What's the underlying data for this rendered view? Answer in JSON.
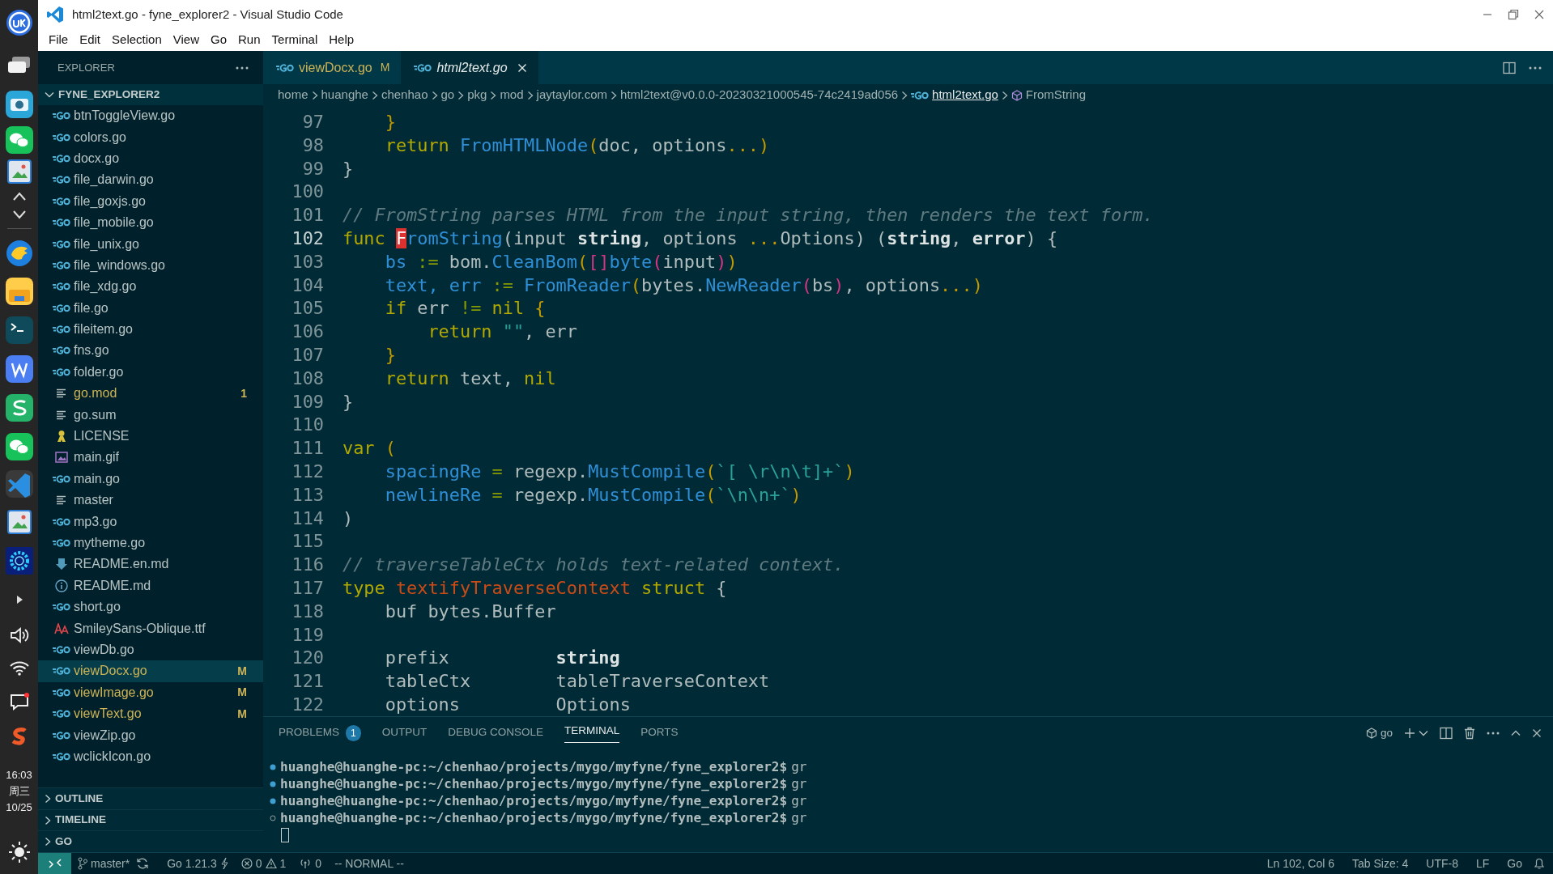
{
  "window": {
    "title": "html2text.go - fyne_explorer2 - Visual Studio Code"
  },
  "taskbar": {
    "time": "16:03",
    "weekday": "周三",
    "date": "10/25"
  },
  "menu": [
    "File",
    "Edit",
    "Selection",
    "View",
    "Go",
    "Run",
    "Terminal",
    "Help"
  ],
  "explorer": {
    "title": "EXPLORER",
    "root": {
      "label": "FYNE_EXPLORER2",
      "expanded": true
    },
    "files": [
      {
        "name": "btnToggleView.go",
        "kind": "go",
        "highlighted": false,
        "selected": false
      },
      {
        "name": "colors.go",
        "kind": "go",
        "highlighted": false,
        "selected": false
      },
      {
        "name": "docx.go",
        "kind": "go",
        "highlighted": false,
        "selected": false
      },
      {
        "name": "file_darwin.go",
        "kind": "go",
        "highlighted": false,
        "selected": false
      },
      {
        "name": "file_goxjs.go",
        "kind": "go",
        "highlighted": false,
        "selected": false
      },
      {
        "name": "file_mobile.go",
        "kind": "go",
        "highlighted": false,
        "selected": false
      },
      {
        "name": "file_unix.go",
        "kind": "go",
        "highlighted": false,
        "selected": false
      },
      {
        "name": "file_windows.go",
        "kind": "go",
        "highlighted": false,
        "selected": false
      },
      {
        "name": "file_xdg.go",
        "kind": "go",
        "highlighted": false,
        "selected": false
      },
      {
        "name": "file.go",
        "kind": "go",
        "highlighted": false,
        "selected": false
      },
      {
        "name": "fileitem.go",
        "kind": "go",
        "highlighted": false,
        "selected": false
      },
      {
        "name": "fns.go",
        "kind": "go",
        "highlighted": false,
        "selected": false
      },
      {
        "name": "folder.go",
        "kind": "go",
        "highlighted": false,
        "selected": false
      },
      {
        "name": "go.mod",
        "kind": "text",
        "highlighted": true,
        "badge": "1",
        "selected": false
      },
      {
        "name": "go.sum",
        "kind": "text",
        "highlighted": false,
        "selected": false
      },
      {
        "name": "LICENSE",
        "kind": "license",
        "highlighted": false,
        "selected": false
      },
      {
        "name": "main.gif",
        "kind": "image",
        "highlighted": false,
        "selected": false
      },
      {
        "name": "main.go",
        "kind": "go",
        "highlighted": false,
        "selected": false
      },
      {
        "name": "master",
        "kind": "text",
        "highlighted": false,
        "selected": false
      },
      {
        "name": "mp3.go",
        "kind": "go",
        "highlighted": false,
        "selected": false
      },
      {
        "name": "mytheme.go",
        "kind": "go",
        "highlighted": false,
        "selected": false
      },
      {
        "name": "README.en.md",
        "kind": "markdown",
        "highlighted": false,
        "selected": false
      },
      {
        "name": "README.md",
        "kind": "info",
        "highlighted": false,
        "selected": false
      },
      {
        "name": "short.go",
        "kind": "go",
        "highlighted": false,
        "selected": false
      },
      {
        "name": "SmileySans-Oblique.ttf",
        "kind": "font",
        "highlighted": false,
        "selected": false
      },
      {
        "name": "viewDb.go",
        "kind": "go",
        "highlighted": false,
        "selected": false
      },
      {
        "name": "viewDocx.go",
        "kind": "go",
        "highlighted": true,
        "badge": "M",
        "selected": true
      },
      {
        "name": "viewImage.go",
        "kind": "go",
        "highlighted": true,
        "badge": "M",
        "selected": false
      },
      {
        "name": "viewText.go",
        "kind": "go",
        "highlighted": true,
        "badge": "M",
        "selected": false
      },
      {
        "name": "viewZip.go",
        "kind": "go",
        "highlighted": false,
        "selected": false
      },
      {
        "name": "wclickIcon.go",
        "kind": "go",
        "highlighted": false,
        "selected": false
      }
    ],
    "sections": [
      {
        "label": "OUTLINE",
        "expanded": false
      },
      {
        "label": "TIMELINE",
        "expanded": false
      },
      {
        "label": "GO",
        "expanded": false
      }
    ]
  },
  "tabs": [
    {
      "label": "viewDocx.go",
      "badge": "M",
      "modified": true,
      "preview": false,
      "selected": false
    },
    {
      "label": "html2text.go",
      "modified": false,
      "preview": true,
      "selected": true
    }
  ],
  "breadcrumbs": [
    {
      "label": "home",
      "kind": "folder",
      "hovered": false
    },
    {
      "label": "huanghe",
      "kind": "folder",
      "hovered": false
    },
    {
      "label": "chenhao",
      "kind": "folder",
      "hovered": false
    },
    {
      "label": "go",
      "kind": "folder",
      "hovered": false
    },
    {
      "label": "pkg",
      "kind": "folder",
      "hovered": false
    },
    {
      "label": "mod",
      "kind": "folder",
      "hovered": false
    },
    {
      "label": "jaytaylor.com",
      "kind": "folder",
      "hovered": false
    },
    {
      "label": "html2text@v0.0.0-20230321000545-74c2419ad056",
      "kind": "folder",
      "hovered": false
    },
    {
      "label": "html2text.go",
      "kind": "file",
      "hovered": true
    },
    {
      "label": "FromString",
      "kind": "symbol",
      "hovered": false
    }
  ],
  "editor": {
    "lines": [
      {
        "number": "97",
        "tokens": [
          {
            "text": "    }",
            "kind": "punc"
          }
        ]
      },
      {
        "number": "98",
        "tokens": [
          {
            "text": "    return ",
            "kind": "kw"
          },
          {
            "text": "FromHTMLNode",
            "kind": "fn"
          },
          {
            "text": "(",
            "kind": "punc"
          },
          {
            "text": "doc, options",
            "kind": "id"
          },
          {
            "text": "...)",
            "kind": "punc"
          }
        ]
      },
      {
        "number": "99",
        "tokens": [
          {
            "text": "}",
            "kind": "id"
          }
        ]
      },
      {
        "number": "100"
      },
      {
        "number": "101",
        "tokens": [
          {
            "text": "// FromString parses HTML from the input string, then renders the text form.",
            "kind": "com"
          }
        ]
      },
      {
        "number": "102",
        "current": true,
        "tokens": [
          {
            "text": "func ",
            "kind": "kw"
          },
          {
            "text": "F",
            "kind": "cursor"
          },
          {
            "text": "romString",
            "kind": "fn"
          },
          {
            "text": "(input ",
            "kind": "id"
          },
          {
            "text": "string",
            "kind": "bold"
          },
          {
            "text": ", options ",
            "kind": "id"
          },
          {
            "text": "...",
            "kind": "punc"
          },
          {
            "text": "Options) (",
            "kind": "id"
          },
          {
            "text": "string",
            "kind": "bold"
          },
          {
            "text": ", ",
            "kind": "id"
          },
          {
            "text": "error",
            "kind": "bold"
          },
          {
            "text": ") {",
            "kind": "id"
          }
        ]
      },
      {
        "number": "103",
        "tokens": [
          {
            "text": "    bs",
            "kind": "var"
          },
          {
            "text": " := ",
            "kind": "op"
          },
          {
            "text": "bom.",
            "kind": "id"
          },
          {
            "text": "CleanBom",
            "kind": "fn"
          },
          {
            "text": "(",
            "kind": "punc"
          },
          {
            "text": "[]",
            "kind": "br"
          },
          {
            "text": "byte",
            "kind": "fn"
          },
          {
            "text": "(",
            "kind": "br"
          },
          {
            "text": "input",
            "kind": "id"
          },
          {
            "text": ")",
            "kind": "br"
          },
          {
            "text": ")",
            "kind": "punc"
          }
        ]
      },
      {
        "number": "104",
        "tokens": [
          {
            "text": "    text, err",
            "kind": "var"
          },
          {
            "text": " := ",
            "kind": "op"
          },
          {
            "text": "FromReader",
            "kind": "fn"
          },
          {
            "text": "(",
            "kind": "punc"
          },
          {
            "text": "bytes.",
            "kind": "id"
          },
          {
            "text": "NewReader",
            "kind": "fn"
          },
          {
            "text": "(",
            "kind": "br"
          },
          {
            "text": "bs",
            "kind": "id"
          },
          {
            "text": ")",
            "kind": "br"
          },
          {
            "text": ", options",
            "kind": "id"
          },
          {
            "text": "...)",
            "kind": "punc"
          }
        ]
      },
      {
        "number": "105",
        "tokens": [
          {
            "text": "    if ",
            "kind": "kw"
          },
          {
            "text": "err ",
            "kind": "id"
          },
          {
            "text": "!= ",
            "kind": "op"
          },
          {
            "text": "nil ",
            "kind": "kw"
          },
          {
            "text": "{",
            "kind": "punc"
          }
        ]
      },
      {
        "number": "106",
        "tokens": [
          {
            "text": "        return ",
            "kind": "kw"
          },
          {
            "text": "\"\"",
            "kind": "str"
          },
          {
            "text": ", err",
            "kind": "id"
          }
        ]
      },
      {
        "number": "107",
        "tokens": [
          {
            "text": "    }",
            "kind": "punc"
          }
        ]
      },
      {
        "number": "108",
        "tokens": [
          {
            "text": "    return ",
            "kind": "kw"
          },
          {
            "text": "text, ",
            "kind": "id"
          },
          {
            "text": "nil",
            "kind": "kw"
          }
        ]
      },
      {
        "number": "109",
        "tokens": [
          {
            "text": "}",
            "kind": "id"
          }
        ]
      },
      {
        "number": "110"
      },
      {
        "number": "111",
        "tokens": [
          {
            "text": "var ",
            "kind": "kw"
          },
          {
            "text": "(",
            "kind": "punc"
          }
        ]
      },
      {
        "number": "112",
        "tokens": [
          {
            "text": "    spacingRe",
            "kind": "var"
          },
          {
            "text": " = ",
            "kind": "op"
          },
          {
            "text": "regexp.",
            "kind": "id"
          },
          {
            "text": "MustCompile",
            "kind": "fn"
          },
          {
            "text": "(",
            "kind": "punc"
          },
          {
            "text": "`[ \\r\\n\\t]+`",
            "kind": "str"
          },
          {
            "text": ")",
            "kind": "punc"
          }
        ]
      },
      {
        "number": "113",
        "tokens": [
          {
            "text": "    newlineRe",
            "kind": "var"
          },
          {
            "text": " = ",
            "kind": "op"
          },
          {
            "text": "regexp.",
            "kind": "id"
          },
          {
            "text": "MustCompile",
            "kind": "fn"
          },
          {
            "text": "(",
            "kind": "punc"
          },
          {
            "text": "`\\n\\n+`",
            "kind": "str"
          },
          {
            "text": ")",
            "kind": "punc"
          }
        ]
      },
      {
        "number": "114",
        "tokens": [
          {
            "text": ")",
            "kind": "id"
          }
        ]
      },
      {
        "number": "115"
      },
      {
        "number": "116",
        "tokens": [
          {
            "text": "// traverseTableCtx holds text-related context.",
            "kind": "com"
          }
        ]
      },
      {
        "number": "117",
        "tokens": [
          {
            "text": "type ",
            "kind": "kw"
          },
          {
            "text": "textifyTraverseContext",
            "kind": "type"
          },
          {
            "text": " struct ",
            "kind": "kw"
          },
          {
            "text": "{",
            "kind": "id"
          }
        ]
      },
      {
        "number": "118",
        "tokens": [
          {
            "text": "    buf bytes.Buffer",
            "kind": "id"
          }
        ]
      },
      {
        "number": "119"
      },
      {
        "number": "120",
        "tokens": [
          {
            "text": "    prefix          ",
            "kind": "id"
          },
          {
            "text": "string",
            "kind": "bold"
          }
        ]
      },
      {
        "number": "121",
        "tokens": [
          {
            "text": "    tableCtx        tableTraverseContext",
            "kind": "id"
          }
        ]
      },
      {
        "number": "122",
        "tokens": [
          {
            "text": "    options         Options",
            "kind": "id"
          }
        ]
      }
    ]
  },
  "panel": {
    "tabs": [
      {
        "label": "PROBLEMS",
        "badge": "1",
        "selected": false
      },
      {
        "label": "OUTPUT",
        "selected": false
      },
      {
        "label": "DEBUG CONSOLE",
        "selected": false
      },
      {
        "label": "TERMINAL",
        "selected": true
      },
      {
        "label": "PORTS",
        "selected": false
      }
    ],
    "terminal_name": "go",
    "terminal": [
      {
        "prompt": "huanghe@huanghe-pc:~/chenhao/projects/mygo/myfyne/fyne_explorer2$",
        "command": "gr",
        "finished": true
      },
      {
        "prompt": "huanghe@huanghe-pc:~/chenhao/projects/mygo/myfyne/fyne_explorer2$",
        "command": "gr",
        "finished": true
      },
      {
        "prompt": "huanghe@huanghe-pc:~/chenhao/projects/mygo/myfyne/fyne_explorer2$",
        "command": "gr",
        "finished": true
      },
      {
        "prompt": "huanghe@huanghe-pc:~/chenhao/projects/mygo/myfyne/fyne_explorer2$",
        "command": "gr",
        "finished": false
      }
    ]
  },
  "status_bar": {
    "branch": "master*",
    "go_version": "Go 1.21.3",
    "errors": "0",
    "warnings": "1",
    "ports": "0",
    "mode": "-- NORMAL --",
    "right": [
      "Ln 102, Col 6",
      "Tab Size: 4",
      "UTF-8",
      "LF",
      "Go"
    ]
  }
}
